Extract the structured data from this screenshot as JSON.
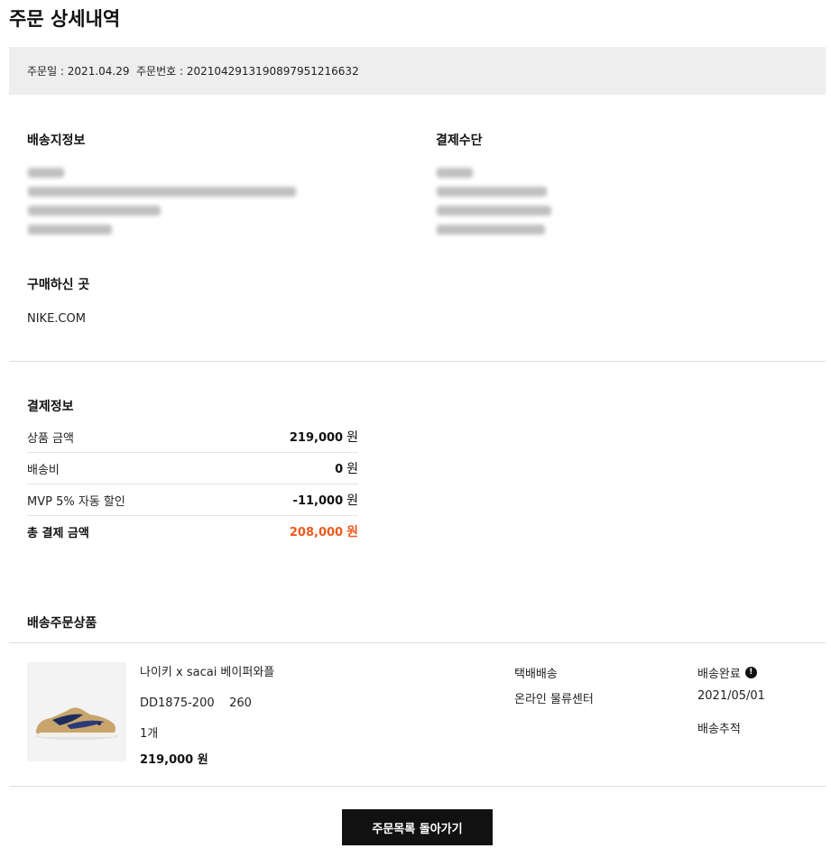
{
  "page": {
    "title": "주문 상세내역"
  },
  "order": {
    "date_text": "주문일 : 2021.04.29",
    "number_text": "주문번호 : 202104291319089795121663​2"
  },
  "shipping": {
    "title": "배송지정보"
  },
  "payment_method": {
    "title": "결제수단"
  },
  "purchase_place": {
    "title": "구매하신 곳",
    "value": "NIKE.COM"
  },
  "payment_info": {
    "title": "결제정보",
    "rows": [
      {
        "label": "상품 금액",
        "amount": "219,000",
        "unit": "원"
      },
      {
        "label": "배송비",
        "amount": "0",
        "unit": "원"
      },
      {
        "label": "MVP 5% 자동 할인",
        "amount": "-11,000",
        "unit": "원"
      },
      {
        "label": "총 결제 금액",
        "amount": "208,000",
        "unit": "원"
      }
    ]
  },
  "delivery_products": {
    "title": "배송주문상품",
    "item": {
      "name": "나이키 x sacai 베이퍼와플",
      "code_size": "DD1875-200    260",
      "quantity": "1개",
      "price": "219,000 원",
      "shipping_type": "택배배송",
      "shipping_from": "온라인 물류센터",
      "status": "배송완료",
      "status_icon": "!",
      "delivered_date": "2021/05/01",
      "track_label": "배송추적"
    }
  },
  "actions": {
    "back_label": "주문목록 돌아가기"
  },
  "colors": {
    "accent_total": "#ee5a1c",
    "button_bg": "#111111",
    "bar_bg": "#eeeeee"
  }
}
